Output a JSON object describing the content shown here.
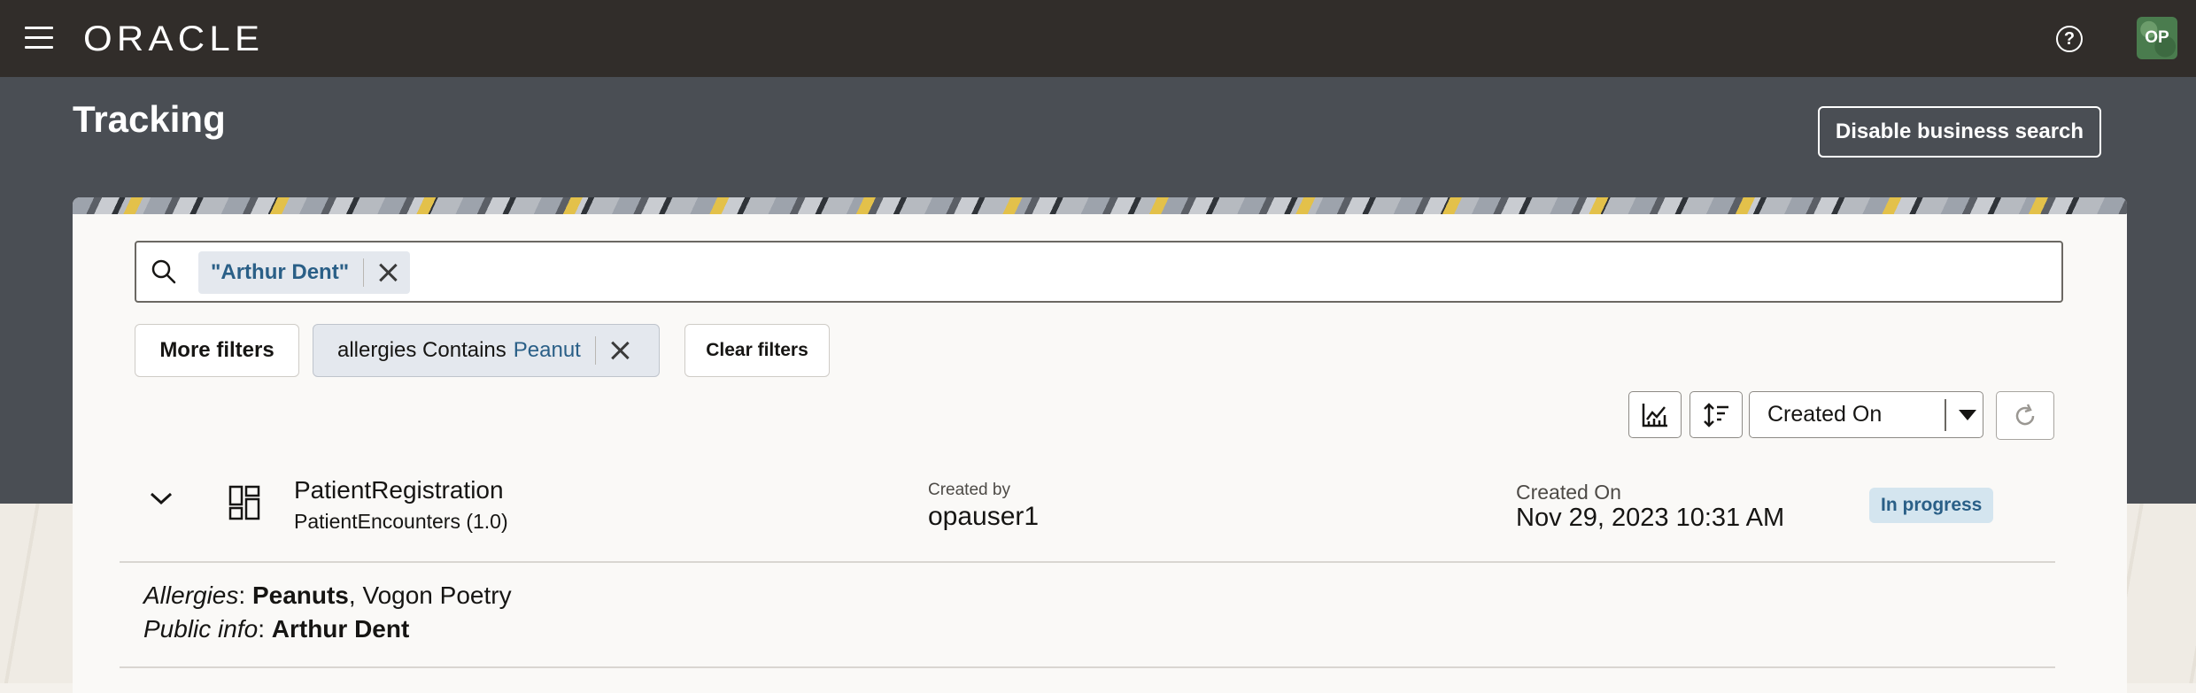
{
  "header": {
    "logo_text": "ORACLE",
    "help_icon": "question-circle-icon",
    "avatar_initials": "OP"
  },
  "page": {
    "title": "Tracking",
    "disable_business_search_label": "Disable business search"
  },
  "search": {
    "chip_text": "\"Arthur Dent\"",
    "placeholder": ""
  },
  "filters": {
    "more_filters_label": "More filters",
    "active_filter": {
      "field_text": "allergies Contains",
      "value_text": "Peanut"
    },
    "clear_filters_label": "Clear filters"
  },
  "toolbar": {
    "chart_icon": "chart-icon",
    "sort_order_icon": "sort-order-icon",
    "sort_by_value": "Created On",
    "refresh_icon": "refresh-icon"
  },
  "results": [
    {
      "name": "PatientRegistration",
      "subtitle": "PatientEncounters (1.0)",
      "created_by_label": "Created by",
      "created_by": "opauser1",
      "created_on_label": "Created On",
      "created_on": "Nov 29, 2023 10:31 AM",
      "status": "In progress",
      "details": [
        {
          "label": "Allergies",
          "sep": ": ",
          "bold": "Peanuts",
          "rest": ", Vogon Poetry"
        },
        {
          "label": "Public info",
          "sep": ": ",
          "bold": "Arthur Dent",
          "rest": ""
        }
      ]
    }
  ],
  "colors": {
    "topbar": "#312d2a",
    "hero": "#4a4e54",
    "chip_text": "#2a5f87",
    "status_bg": "#d4e5ef"
  }
}
